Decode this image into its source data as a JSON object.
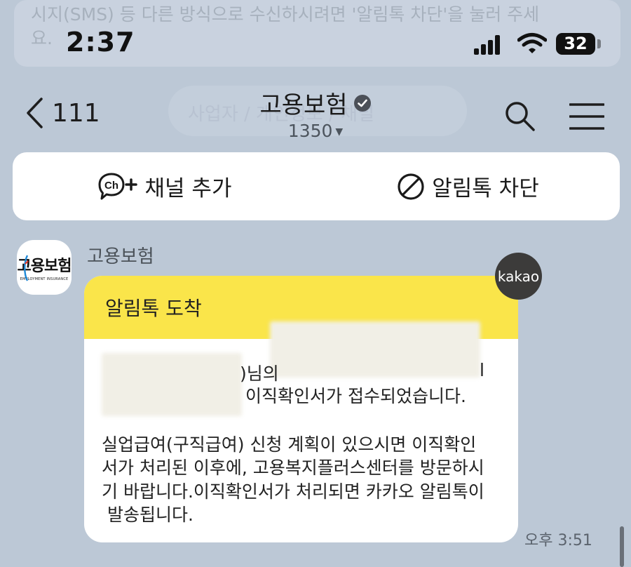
{
  "notice": {
    "line1": "시지(SMS) 등 다른 방식으로 수신하시려면 '알림톡 차단'을 눌러 주세",
    "line2": "요."
  },
  "status_bar": {
    "time": "2:37",
    "battery": "32"
  },
  "header": {
    "back_count": "111",
    "title": "고용보험",
    "subtitle": "1350",
    "ghost_text": "사업자 / 개인정보 / 채널"
  },
  "actions": {
    "add_channel": "채널 추가",
    "block": "알림톡 차단"
  },
  "message": {
    "avatar_text": "고용보험",
    "avatar_sub": "EMPLOYMENT INSURANCE",
    "sender": "고용보험",
    "badge": "kakao",
    "header": "알림톡 도착",
    "line1_fragment": ")님의",
    "line1_end": "l",
    "line2": "이직확인서가 접수되었습니다.",
    "para": [
      "실업급여(구직급여) 신청 계획이 있으시면 이직확인",
      "서가 처리된 이후에, 고용복지플러스센터를 방문하시",
      "기 바랍니다.이직확인서가 처리되면 카카오 알림톡이",
      " 발송됩니다."
    ],
    "time": "오후 3:51"
  },
  "colors": {
    "background": "#bcc8d6",
    "bubble_header": "#fae54a",
    "badge": "#3c3b3a"
  }
}
